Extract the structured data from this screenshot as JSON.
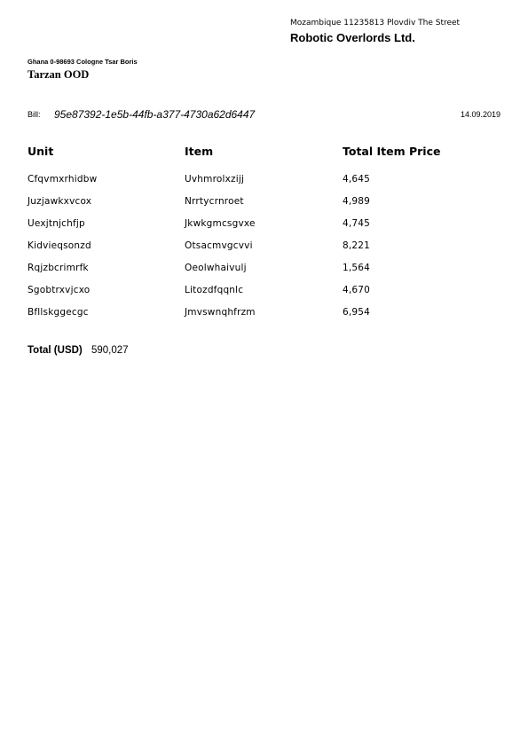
{
  "sender": {
    "address": "Mozambique 11235813 Plovdiv The Street",
    "name": "Robotic Overlords Ltd."
  },
  "recipient": {
    "address": "Ghana 0-98693 Cologne Tsar Boris",
    "name": "Tarzan OOD"
  },
  "bill": {
    "label": "Bill:",
    "id": "95e87392-1e5b-44fb-a377-4730a62d6447",
    "date": "14.09.2019"
  },
  "table": {
    "headers": [
      "Unit",
      "Item",
      "Total Item Price"
    ],
    "rows": [
      [
        "Cfqvmxrhidbw",
        "Uvhmrolxzijj",
        "4,645"
      ],
      [
        "Juzjawkxvcox",
        "Nrrtycrnroet",
        "4,989"
      ],
      [
        "Uexjtnjchfjp",
        "Jkwkgmcsgvxe",
        "4,745"
      ],
      [
        "Kidvieqsonzd",
        "Otsacmvgcvvi",
        "8,221"
      ],
      [
        "Rqjzbcrimrfk",
        "Oeolwhaivulj",
        "1,564"
      ],
      [
        "Sgobtrxvjcxo",
        "Litozdfqqnlc",
        "4,670"
      ],
      [
        "Bfllskggecgc",
        "Jmvswnqhfrzm",
        "6,954"
      ]
    ]
  },
  "total": {
    "label": "Total (USD)",
    "value": "590,027"
  }
}
